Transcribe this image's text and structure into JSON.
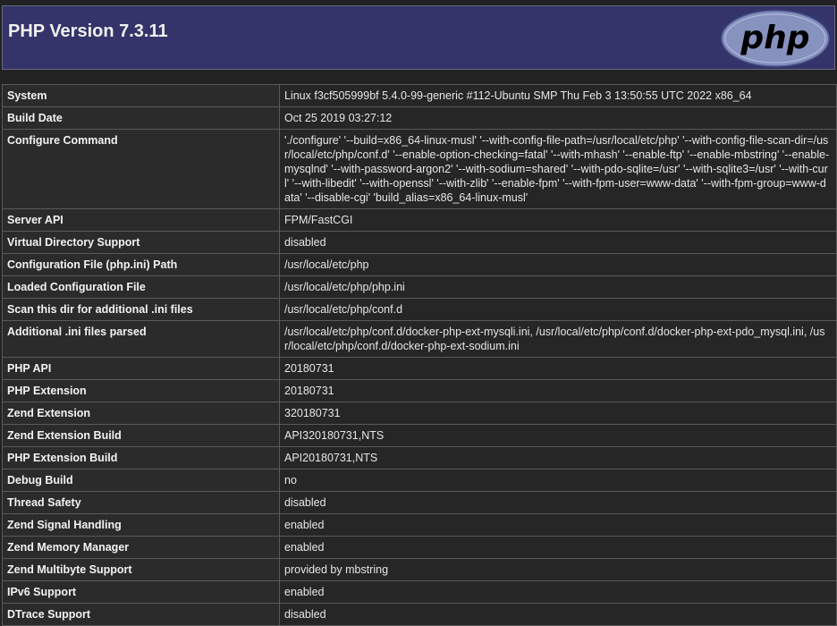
{
  "header": {
    "title": "PHP Version 7.3.11",
    "logo_text": "php"
  },
  "rows": [
    {
      "key": "System",
      "value": "Linux f3cf505999bf 5.4.0-99-generic #112-Ubuntu SMP Thu Feb 3 13:50:55 UTC 2022 x86_64"
    },
    {
      "key": "Build Date",
      "value": "Oct 25 2019 03:27:12"
    },
    {
      "key": "Configure Command",
      "value": "'./configure' '--build=x86_64-linux-musl' '--with-config-file-path=/usr/local/etc/php' '--with-config-file-scan-dir=/usr/local/etc/php/conf.d' '--enable-option-checking=fatal' '--with-mhash' '--enable-ftp' '--enable-mbstring' '--enable-mysqlnd' '--with-password-argon2' '--with-sodium=shared' '--with-pdo-sqlite=/usr' '--with-sqlite3=/usr' '--with-curl' '--with-libedit' '--with-openssl' '--with-zlib' '--enable-fpm' '--with-fpm-user=www-data' '--with-fpm-group=www-data' '--disable-cgi' 'build_alias=x86_64-linux-musl'"
    },
    {
      "key": "Server API",
      "value": "FPM/FastCGI"
    },
    {
      "key": "Virtual Directory Support",
      "value": "disabled"
    },
    {
      "key": "Configuration File (php.ini) Path",
      "value": "/usr/local/etc/php"
    },
    {
      "key": "Loaded Configuration File",
      "value": "/usr/local/etc/php/php.ini"
    },
    {
      "key": "Scan this dir for additional .ini files",
      "value": "/usr/local/etc/php/conf.d"
    },
    {
      "key": "Additional .ini files parsed",
      "value": "/usr/local/etc/php/conf.d/docker-php-ext-mysqli.ini, /usr/local/etc/php/conf.d/docker-php-ext-pdo_mysql.ini, /usr/local/etc/php/conf.d/docker-php-ext-sodium.ini"
    },
    {
      "key": "PHP API",
      "value": "20180731"
    },
    {
      "key": "PHP Extension",
      "value": "20180731"
    },
    {
      "key": "Zend Extension",
      "value": "320180731"
    },
    {
      "key": "Zend Extension Build",
      "value": "API320180731,NTS"
    },
    {
      "key": "PHP Extension Build",
      "value": "API20180731,NTS"
    },
    {
      "key": "Debug Build",
      "value": "no"
    },
    {
      "key": "Thread Safety",
      "value": "disabled"
    },
    {
      "key": "Zend Signal Handling",
      "value": "enabled"
    },
    {
      "key": "Zend Memory Manager",
      "value": "enabled"
    },
    {
      "key": "Zend Multibyte Support",
      "value": "provided by mbstring"
    },
    {
      "key": "IPv6 Support",
      "value": "enabled"
    },
    {
      "key": "DTrace Support",
      "value": "disabled"
    }
  ]
}
